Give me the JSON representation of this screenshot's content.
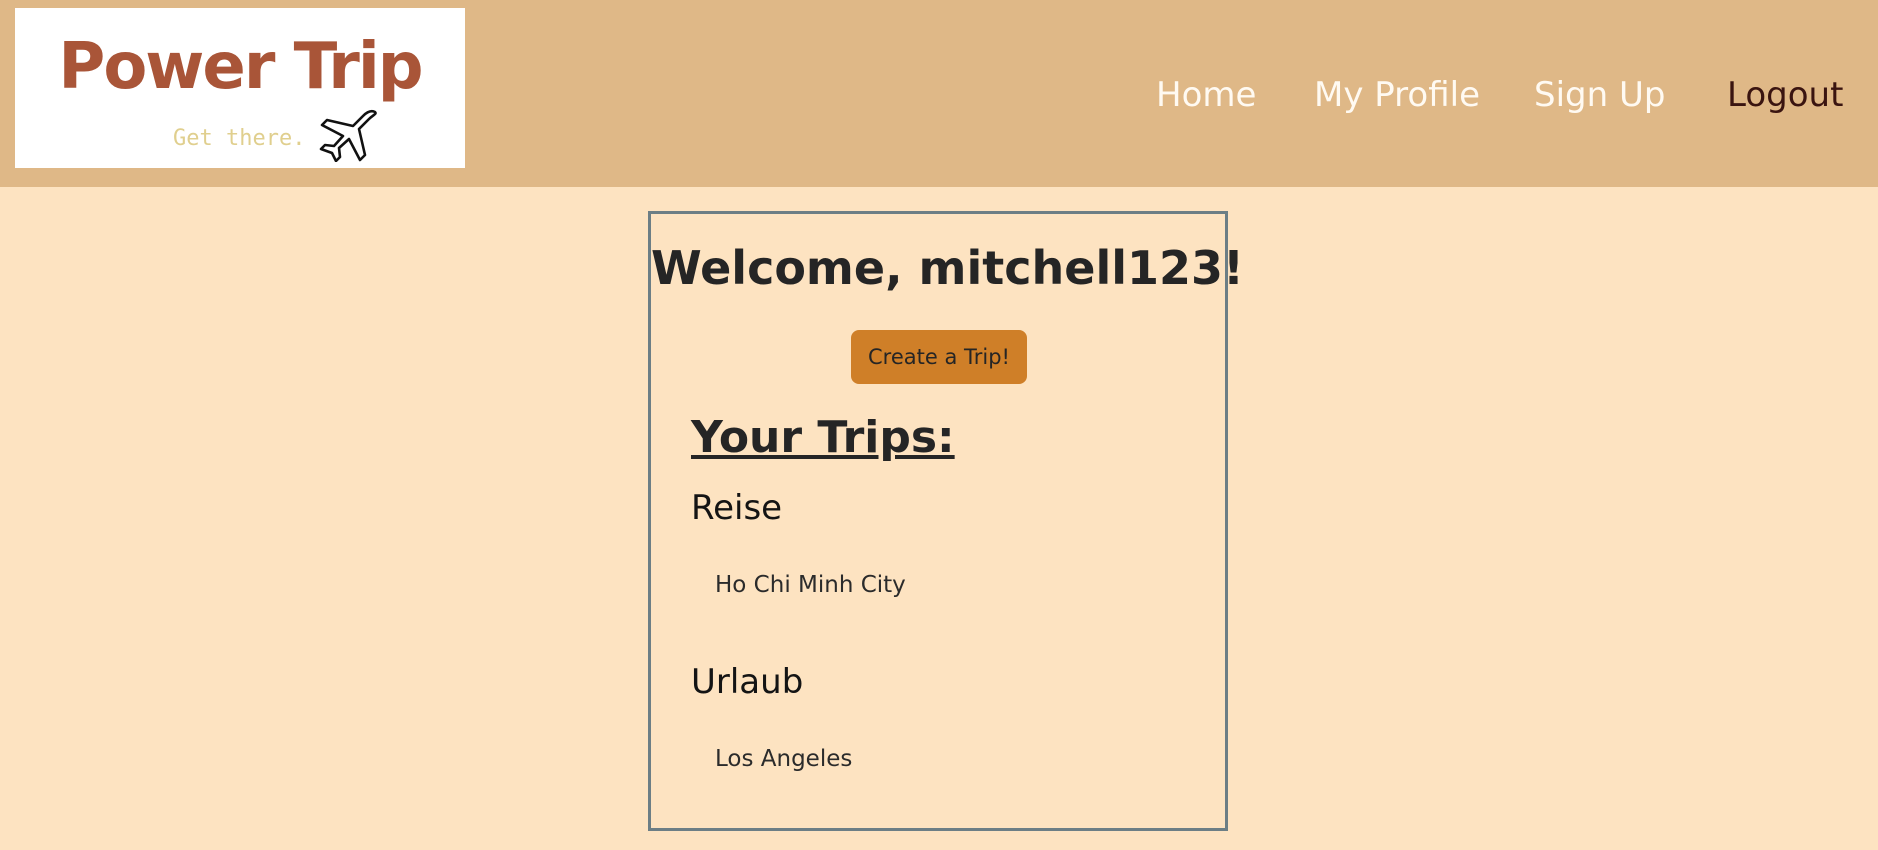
{
  "header": {
    "logo": {
      "title": "Power Trip",
      "tagline": "Get there.",
      "icon": "airplane-icon"
    },
    "nav": [
      {
        "label": "Home"
      },
      {
        "label": "My Profile"
      },
      {
        "label": "Sign Up"
      },
      {
        "label": "Logout"
      }
    ]
  },
  "main": {
    "welcome": "Welcome, mitchell123!",
    "create_button_label": "Create a Trip!",
    "trips_heading": "Your Trips:",
    "trips": [
      {
        "name": "Reise",
        "destination": "Ho Chi Minh City"
      },
      {
        "name": "Urlaub",
        "destination": "Los Angeles"
      }
    ]
  },
  "colors": {
    "page_background": "#fde3c1",
    "header_background": "#dfb887",
    "logo_text": "#a95538",
    "button": "#cf7f28",
    "card_border": "#6c7e85"
  }
}
